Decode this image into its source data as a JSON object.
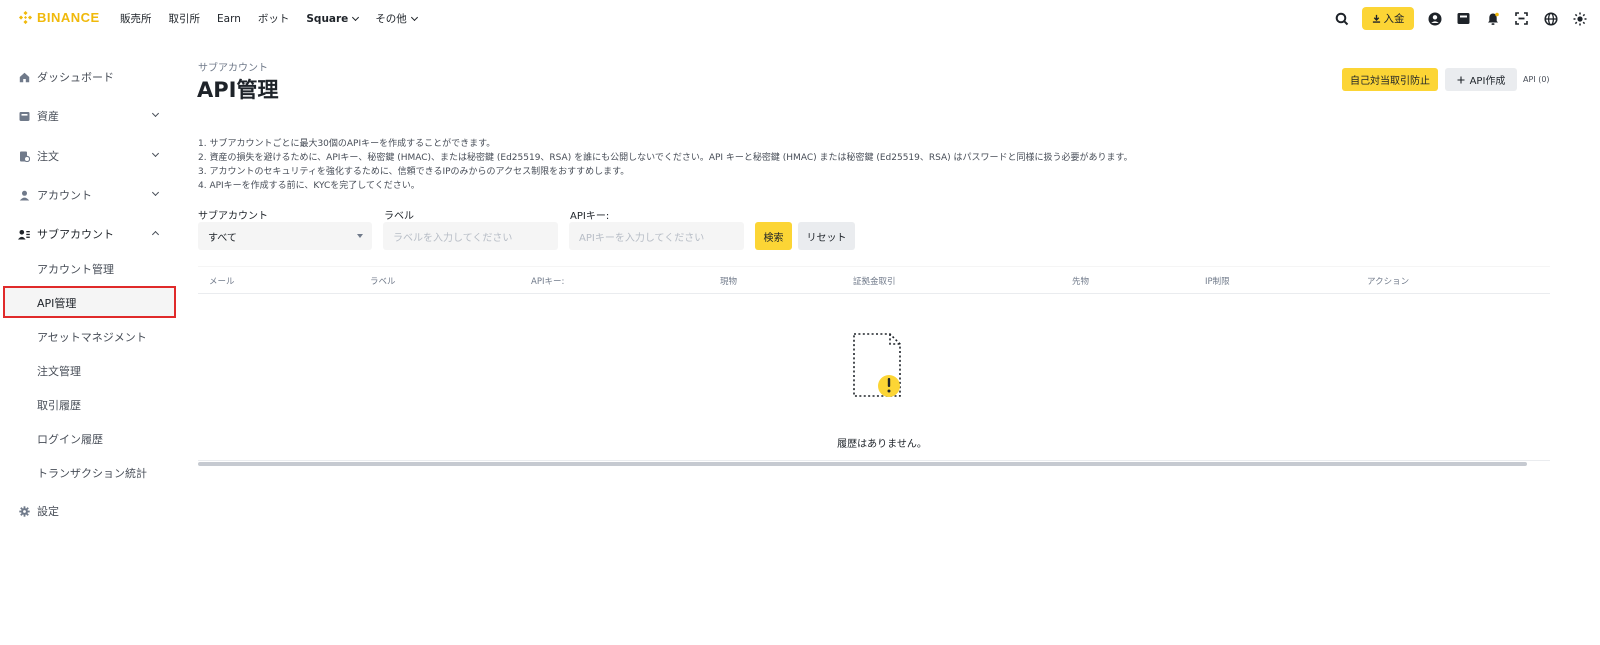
{
  "nav": {
    "logo": "BINANCE",
    "items": [
      {
        "label": "販売所",
        "dropdown": false
      },
      {
        "label": "取引所",
        "dropdown": false
      },
      {
        "label": "Earn",
        "dropdown": false
      },
      {
        "label": "ボット",
        "dropdown": false
      },
      {
        "label": "Square",
        "dropdown": true
      },
      {
        "label": "その他",
        "dropdown": true
      }
    ],
    "deposit": "入金"
  },
  "sidebar": {
    "dashboard": "ダッシュボード",
    "assets": "資産",
    "orders": "注文",
    "account": "アカウント",
    "subaccount": "サブアカウント",
    "subitems": [
      "アカウント管理",
      "API管理",
      "アセットマネジメント",
      "注文管理",
      "取引履歴",
      "ログイン履歴",
      "トランザクション統計"
    ],
    "settings": "設定"
  },
  "main": {
    "breadcrumb": "サブアカウント",
    "title": "API管理",
    "self_trade_btn": "自己対当取引防止",
    "create_api_btn": "API作成",
    "api_count": "API (0)",
    "notes": [
      "1. サブアカウントごとに最大30個のAPIキーを作成することができます。",
      "2. 資産の損失を避けるために、APIキー、秘密鍵 (HMAC)、または秘密鍵 (Ed25519、RSA) を誰にも公開しないでください。API キーと秘密鍵 (HMAC) または秘密鍵 (Ed25519、RSA) はパスワードと同様に扱う必要があります。",
      "3. アカウントのセキュリティを強化するために、信頼できるIPのみからのアクセス制限をおすすめします。",
      "4. APIキーを作成する前に、KYCを完了してください。"
    ],
    "filters": {
      "subaccount_label": "サブアカウント",
      "subaccount_value": "すべて",
      "label_label": "ラベル",
      "label_placeholder": "ラベルを入力してください",
      "apikey_label": "APIキー:",
      "apikey_placeholder": "APIキーを入力してください",
      "search": "検索",
      "reset": "リセット"
    },
    "table": {
      "headers": [
        "メール",
        "ラベル",
        "APIキー:",
        "現物",
        "証拠金取引",
        "先物",
        "IP制限",
        "アクション"
      ]
    },
    "empty": "履歴はありません。"
  },
  "colors": {
    "accent": "#fcd535",
    "brand": "#f0b90b",
    "highlight": "#e02a2a"
  }
}
